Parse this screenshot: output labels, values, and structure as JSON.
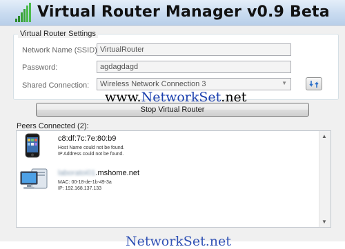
{
  "window": {
    "title": "Virtual Router Manager v0.9 Beta",
    "icon": "signal-bars-icon"
  },
  "settings": {
    "group_title": "Virtual Router Settings",
    "ssid_label": "Network Name (SSID):",
    "ssid_value": "VirtualRouter",
    "password_label": "Password:",
    "password_value": "agdagdagd",
    "shared_label": "Shared Connection:",
    "shared_value": "Wireless Network Connection 3",
    "refresh_icon": "refresh-icon"
  },
  "watermark": {
    "prefix": "www.",
    "brand": "NetworkSet",
    "suffix": ".net"
  },
  "actions": {
    "stop_label": "Stop Virtual Router"
  },
  "peers": {
    "label": "Peers Connected (2):",
    "items": [
      {
        "icon": "iphone-icon",
        "mac": "c8:df:7c:7e:80:b9",
        "line1": "Host Name could not be found.",
        "line2": "IP Address could not be found."
      },
      {
        "icon": "computer-icon",
        "host_blurred": "laboratoi01",
        "host_suffix": ".mshome.net",
        "line1": "MAC: 00-18-de-1b-49-3a",
        "line2": "IP: 192.168.137.133"
      }
    ]
  },
  "footer_watermark": "NetworkSet.net",
  "colors": {
    "title_bar": "#c9dbf0",
    "watermark_brand": "#1a3fae",
    "window_bg": "#f0f0f0"
  }
}
